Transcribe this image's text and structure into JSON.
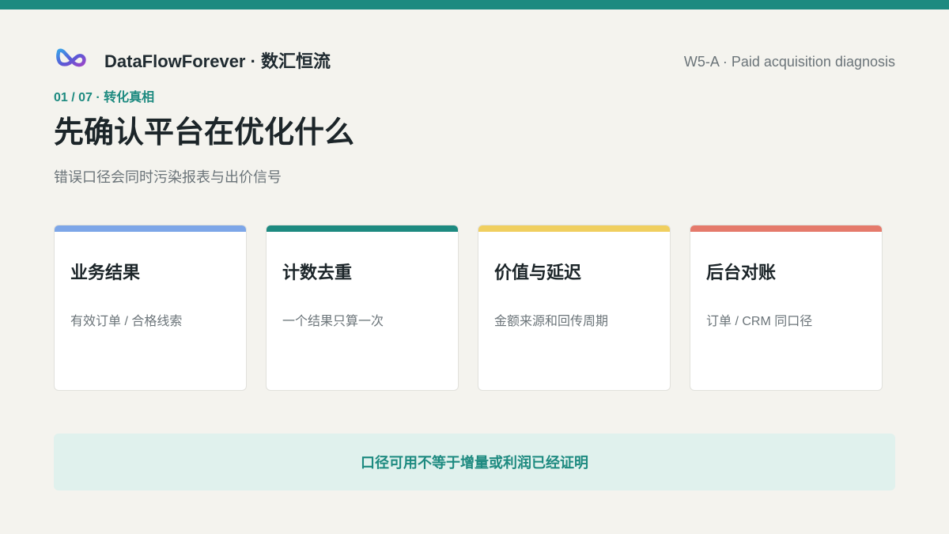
{
  "header": {
    "brand_name": "DataFlowForever · 数汇恒流",
    "logo_icon": "infinity-logo-icon",
    "deck_tag": "W5-A · Paid acquisition diagnosis"
  },
  "slide": {
    "kicker": "01 / 07 · 转化真相",
    "title": "先确认平台在优化什么",
    "subtitle": "错误口径会同时污染报表与出价信号"
  },
  "cards": [
    {
      "title": "业务结果",
      "desc": "有效订单 / 合格线索",
      "accent": "#7da6e8"
    },
    {
      "title": "计数去重",
      "desc": "一个结果只算一次",
      "accent": "#1d8a80"
    },
    {
      "title": "价值与延迟",
      "desc": "金额来源和回传周期",
      "accent": "#f0cf5f"
    },
    {
      "title": "后台对账",
      "desc": "订单 / CRM 同口径",
      "accent": "#e57a6b"
    }
  ],
  "callout": {
    "text": "口径可用不等于增量或利润已经证明"
  },
  "colors": {
    "brand_teal": "#1d8a80",
    "background": "#f4f3ee",
    "callout_bg": "#e0f1ed"
  }
}
